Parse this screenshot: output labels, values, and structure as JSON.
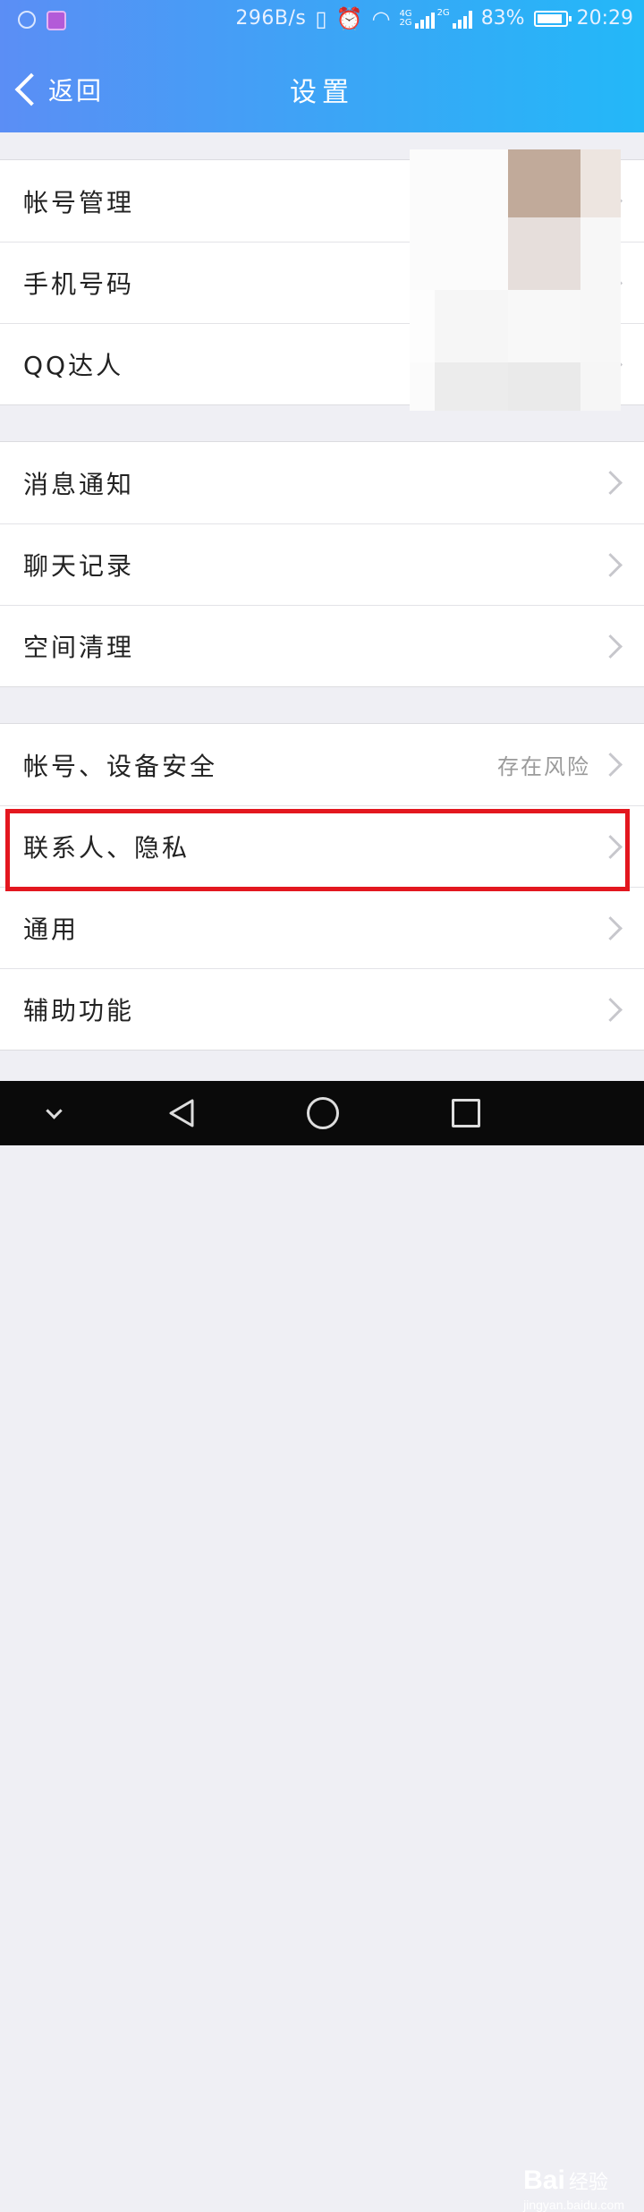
{
  "status_bar": {
    "net_speed": "296B/s",
    "sim1_label": "4G",
    "sim1_label2": "2G",
    "sim2_label": "2G",
    "battery": "83%",
    "battery_level": 0.83,
    "time": "20:29",
    "icons": [
      "app-icon",
      "gallery-icon",
      "vibrate-icon",
      "alarm-icon",
      "wifi-icon",
      "signal-icon",
      "battery-icon"
    ]
  },
  "header": {
    "back_label": "返回",
    "title": "设置"
  },
  "groups": [
    {
      "items": [
        {
          "label": "帐号管理"
        },
        {
          "label": "手机号码"
        },
        {
          "label": "QQ达人"
        }
      ]
    },
    {
      "items": [
        {
          "label": "消息通知"
        },
        {
          "label": "聊天记录"
        },
        {
          "label": "空间清理"
        }
      ]
    },
    {
      "items": [
        {
          "label": "帐号、设备安全",
          "status": "存在风险"
        },
        {
          "label": "联系人、隐私",
          "highlighted": true
        },
        {
          "label": "通用"
        },
        {
          "label": "辅助功能"
        }
      ]
    }
  ],
  "watermark": {
    "brand": "Bai",
    "brand_cn": "经验",
    "url": "jingyan.baidu.com"
  },
  "colors": {
    "header_start": "#5b8ef5",
    "header_end": "#23b8f8",
    "highlight": "#e3171f",
    "background": "#efeff4"
  }
}
